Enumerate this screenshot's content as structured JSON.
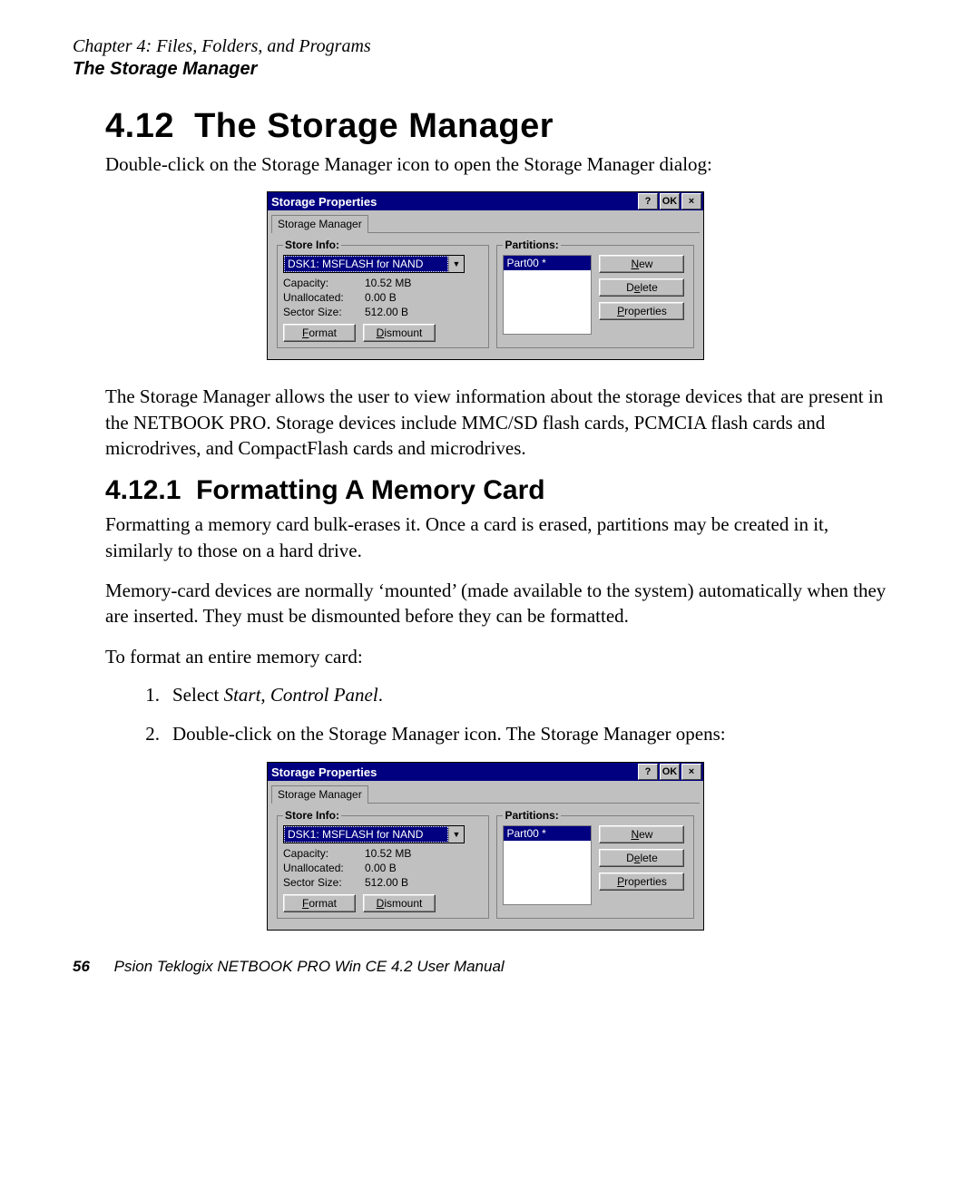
{
  "header": {
    "chapter": "Chapter 4:  Files, Folders, and Programs",
    "section": "The Storage Manager"
  },
  "headings": {
    "h1_num": "4.12",
    "h1_text": "The Storage Manager",
    "h2_num": "4.12.1",
    "h2_text": "Formatting A Memory Card"
  },
  "body": {
    "intro": "Double-click on the Storage Manager icon to open the Storage Manager dialog:",
    "para1": "The Storage Manager allows the user to view information about the storage devices that are present in the NETBOOK PRO. Storage devices include MMC/SD flash cards, PCMCIA flash cards and microdrives, and CompactFlash cards and microdrives.",
    "para2": "Formatting a memory card bulk-erases it. Once a card is erased, partitions may be created in it, similarly to those on a hard drive.",
    "para3": "Memory-card devices are normally ‘mounted’ (made available to the system) automatically when they are inserted. They must be dismounted before they can be formatted.",
    "para4": "To format an entire memory card:",
    "step1_pre": "Select ",
    "step1_em": "Start",
    "step1_mid": ", ",
    "step1_em2": "Control Panel",
    "step1_end": ".",
    "step2": "Double-click on the Storage Manager icon. The Storage Manager opens:"
  },
  "dialog": {
    "title": "Storage Properties",
    "help": "?",
    "ok": "OK",
    "close": "×",
    "tab": "Storage Manager",
    "store_legend": "Store Info:",
    "store_selected": "DSK1: MSFLASH for NAND",
    "capacity_label": "Capacity:",
    "capacity_value": "10.52 MB",
    "unallocated_label": "Unallocated:",
    "unallocated_value": "0.00 B",
    "sector_label": "Sector Size:",
    "sector_value": "512.00 B",
    "format_btn": "Format",
    "dismount_btn": "Dismount",
    "partitions_legend": "Partitions:",
    "partition_item": "Part00 *",
    "new_btn": "New",
    "delete_btn": "Delete",
    "properties_btn": "Properties"
  },
  "footer": {
    "page_number": "56",
    "manual_title": "Psion Teklogix NETBOOK PRO Win CE 4.2 User Manual"
  }
}
